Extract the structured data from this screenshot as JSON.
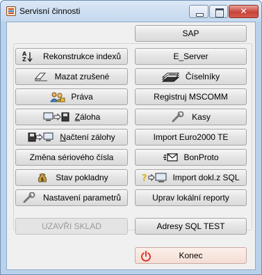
{
  "window": {
    "title": "Servisní činnosti",
    "controls": {
      "minimize": "minimize",
      "maximize": "maximize",
      "close": "close"
    }
  },
  "buttons": {
    "sap": "SAP",
    "left": [
      {
        "label": "Rekonstrukce indexů",
        "icon": "sort-az-icon"
      },
      {
        "label": "Mazat zrušené",
        "icon": "eraser-icon"
      },
      {
        "label": "Práva",
        "icon": "users-key-icon"
      },
      {
        "label_pre": "",
        "label_ul": "Z",
        "label_post": "áloha",
        "icon": "computer-to-disk-icon"
      },
      {
        "label_pre": "",
        "label_ul": "N",
        "label_post": "ačtení zálohy",
        "icon": "disk-to-computer-icon"
      },
      {
        "label": "Změna sériového čísla",
        "icon": ""
      },
      {
        "label": "Stav pokladny",
        "icon": "money-bag-icon"
      },
      {
        "label": "Nastavení parametrů",
        "icon": "wrench-icon"
      },
      {
        "label": "UZAVŘI SKLAD",
        "icon": "",
        "disabled": true
      }
    ],
    "right": [
      {
        "label": "E_Server",
        "icon": ""
      },
      {
        "label": "Číselníky",
        "icon": "code-tables-icon"
      },
      {
        "label": "Registruj MSCOMM",
        "icon": ""
      },
      {
        "label": "Kasy",
        "icon": "wrench-icon"
      },
      {
        "label": "Import Euro2000 TE",
        "icon": ""
      },
      {
        "label": "BonProto",
        "icon": "envelope-icon"
      },
      {
        "label": "Import dokl.z SQL",
        "icon": "question-computer-icon"
      },
      {
        "label": "Uprav lokální reporty",
        "icon": ""
      },
      {
        "label": "Adresy SQL TEST",
        "icon": ""
      }
    ],
    "konec": {
      "label": "Konec",
      "icon": "power-icon"
    }
  },
  "colors": {
    "window_frame": "#b9d1ea",
    "client_bg": "#f0f0f0",
    "close_button": "#c8443a",
    "konec_bg": "#f4ded5",
    "power_icon": "#d9261c"
  }
}
